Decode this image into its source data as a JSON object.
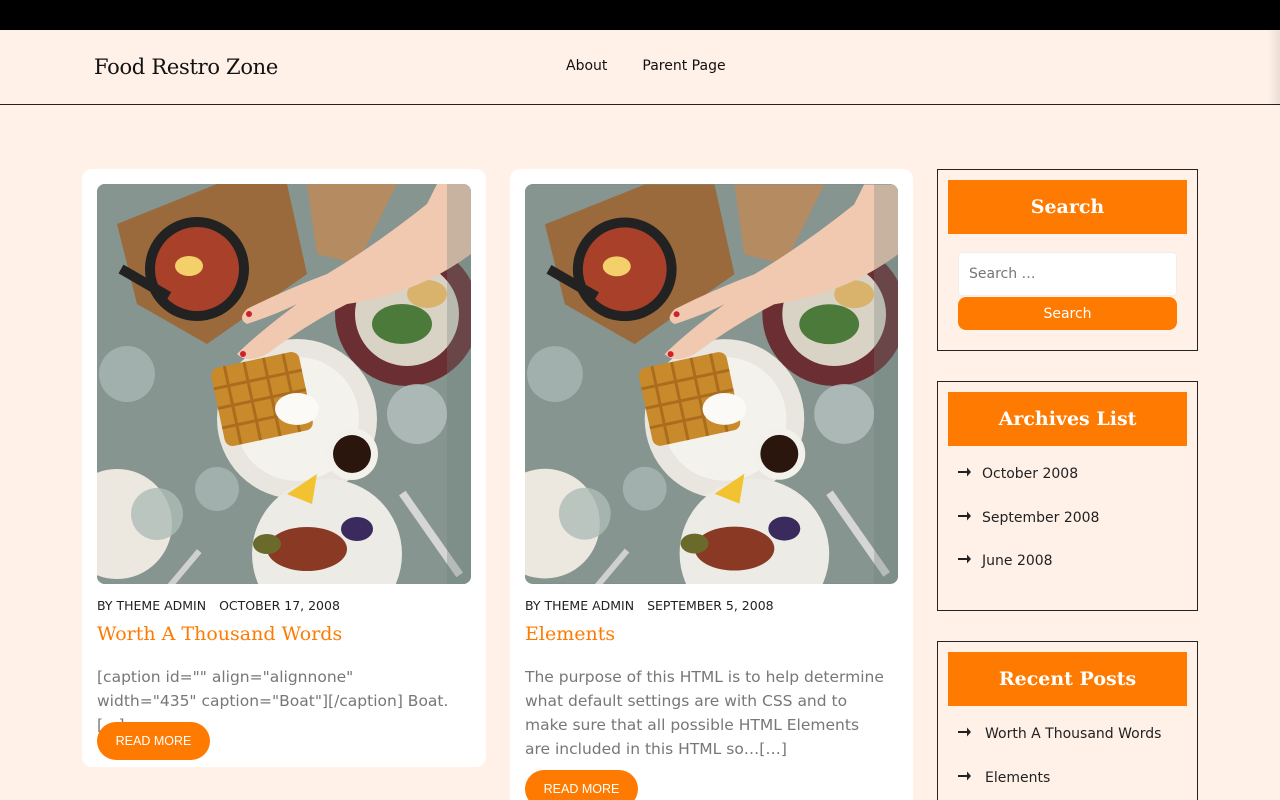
{
  "site": {
    "title": "Food Restro Zone"
  },
  "nav": {
    "items": [
      "About",
      "Parent Page"
    ]
  },
  "posts": [
    {
      "author": "BY THEME ADMIN",
      "date": "OCTOBER 17, 2008",
      "title": "Worth A Thousand Words",
      "excerpt": "[caption id=\"\" align=\"alignnone\" width=\"435\" caption=\"Boat\"][/caption] Boat.[…]",
      "read_more": "READ MORE",
      "image_icon": "food-table-photo"
    },
    {
      "author": "BY THEME ADMIN",
      "date": "SEPTEMBER 5, 2008",
      "title": "Elements",
      "excerpt": "The purpose of this HTML is to help determine what default settings are with CSS and to make sure that all possible HTML Elements are included in this HTML so…[…]",
      "read_more": "READ MORE",
      "image_icon": "food-table-photo"
    }
  ],
  "sidebar": {
    "search": {
      "title": "Search",
      "placeholder": "Search …",
      "button": "Search"
    },
    "archives": {
      "title": "Archives List",
      "items": [
        "October 2008",
        "September 2008",
        "June 2008"
      ]
    },
    "recent": {
      "title": "Recent Posts",
      "items": [
        "Worth A Thousand Words",
        "Elements"
      ]
    }
  },
  "colors": {
    "accent": "#ff7a00",
    "background": "#fff1e8",
    "topbar": "#000000"
  }
}
